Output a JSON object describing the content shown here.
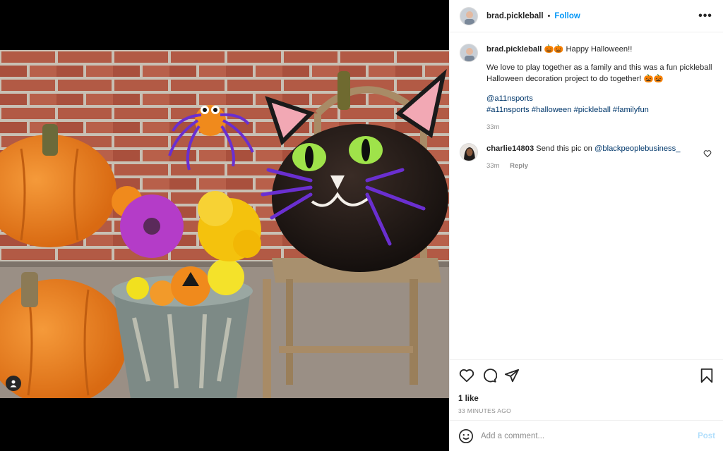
{
  "post": {
    "author": "brad.pickleball",
    "follow_label": "Follow",
    "separator": "•",
    "more_label": "•••"
  },
  "caption": {
    "author": "brad.pickleball",
    "title_emoji": "🎃🎃",
    "title": "Happy Halloween!!",
    "body": "We love to play together as a family and this was a fun pickleball Halloween decoration project to do together! 🎃🎃",
    "mention": "@a11nsports",
    "hashtags": "#a11nsports #halloween #pickleball #familyfun",
    "time": "33m"
  },
  "comments": [
    {
      "author": "charlie14803",
      "text": "Send this pic on",
      "mention": "@blackpeoplebusiness_",
      "time": "33m",
      "reply_label": "Reply"
    }
  ],
  "likes_label": "1 like",
  "timestamp": "33 MINUTES AGO",
  "comment_box": {
    "placeholder": "Add a comment...",
    "post_label": "Post"
  },
  "icons": {
    "like": "heart-icon",
    "comment": "comment-icon",
    "share": "share-icon",
    "save": "bookmark-icon",
    "emoji": "emoji-icon",
    "user_tag": "user-tag-icon"
  },
  "colors": {
    "link": "#0095f6",
    "mention": "#00376b",
    "post_disabled": "#b2dffc"
  }
}
